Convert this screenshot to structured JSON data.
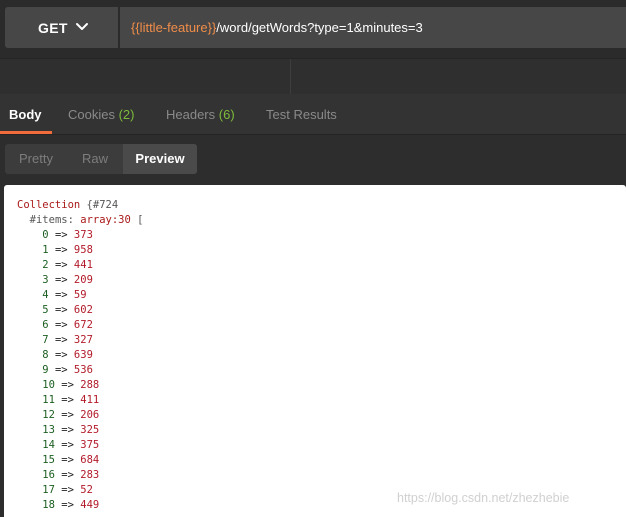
{
  "request": {
    "method": "GET",
    "url_variable": "{{little-feature}}",
    "url_path": "/word/getWords?type=1&minutes=3"
  },
  "tabs": [
    {
      "label": "Body",
      "count": ""
    },
    {
      "label": "Cookies",
      "count": "(2)"
    },
    {
      "label": "Headers",
      "count": "(6)"
    },
    {
      "label": "Test Results",
      "count": ""
    }
  ],
  "format": {
    "pretty": "Pretty",
    "raw": "Raw",
    "preview": "Preview"
  },
  "dump": {
    "class_name": "Collection",
    "object_id": "{#724",
    "items_key": "#items",
    "items_type": "array:30",
    "open_bracket": "[",
    "items": [
      {
        "index": "0",
        "value": "373"
      },
      {
        "index": "1",
        "value": "958"
      },
      {
        "index": "2",
        "value": "441"
      },
      {
        "index": "3",
        "value": "209"
      },
      {
        "index": "4",
        "value": "59"
      },
      {
        "index": "5",
        "value": "602"
      },
      {
        "index": "6",
        "value": "672"
      },
      {
        "index": "7",
        "value": "327"
      },
      {
        "index": "8",
        "value": "639"
      },
      {
        "index": "9",
        "value": "536"
      },
      {
        "index": "10",
        "value": "288"
      },
      {
        "index": "11",
        "value": "411"
      },
      {
        "index": "12",
        "value": "206"
      },
      {
        "index": "13",
        "value": "325"
      },
      {
        "index": "14",
        "value": "375"
      },
      {
        "index": "15",
        "value": "684"
      },
      {
        "index": "16",
        "value": "283"
      },
      {
        "index": "17",
        "value": "52"
      },
      {
        "index": "18",
        "value": "449"
      }
    ]
  },
  "watermark": "https://blog.csdn.net/zhezhebie",
  "colors": {
    "accent": "#f26b3a",
    "url_variable": "#f08d49",
    "count": "#7dbb3c"
  }
}
